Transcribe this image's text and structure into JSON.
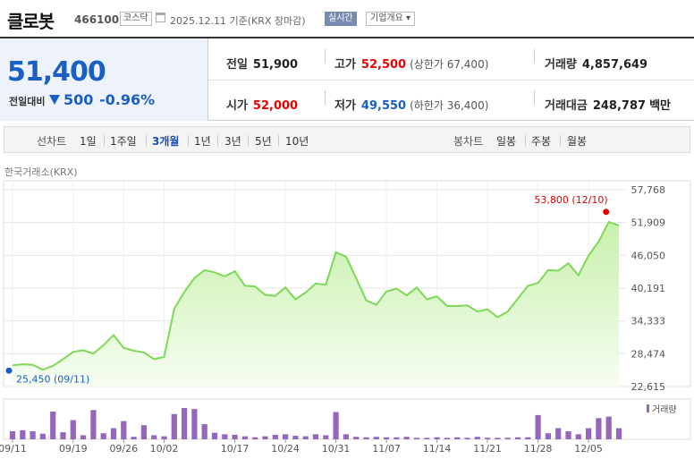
{
  "header": {
    "name": "클로봇",
    "code": "466100",
    "market": "코스닥",
    "date": "2025.12.11 기준(KRX 장마감)",
    "realtime": "실시간",
    "company_info": "기업개요 ▾"
  },
  "quote": {
    "price": "51,400",
    "change_label": "전일대비",
    "change": "500",
    "change_pct": "-0.96%",
    "prev_label": "전일",
    "prev": "51,900",
    "open_label": "시가",
    "open": "52,000",
    "high_label": "고가",
    "high": "52,500",
    "upper_limit": "(상한가 67,400)",
    "low_label": "저가",
    "low": "49,550",
    "lower_limit": "(하한가 36,400)",
    "volume_label": "거래량",
    "volume": "4,857,649",
    "amount_label": "거래대금",
    "amount": "248,787",
    "amount_unit": "백만"
  },
  "periods": {
    "line_label": "선차트",
    "line_items": [
      "1일",
      "1주일",
      "3개월",
      "1년",
      "3년",
      "5년",
      "10년"
    ],
    "active": "3개월",
    "candle_label": "봉차트",
    "candle_items": [
      "일봉",
      "주봉",
      "월봉"
    ]
  },
  "source": "한국거래소(KRX)",
  "colors": {
    "down": "#1a5fc4",
    "up": "#e00000",
    "line": "#7ed957",
    "volume": "#9467bd"
  },
  "chart_data": {
    "type": "area",
    "x_tick_labels": [
      "09/11",
      "09/19",
      "09/26",
      "10/02",
      "10/17",
      "10/24",
      "10/31",
      "11/07",
      "11/14",
      "11/21",
      "11/28",
      "12/05"
    ],
    "y_tick_labels": [
      "57,768",
      "51,909",
      "46,050",
      "40,191",
      "34,333",
      "28,474",
      "22,615"
    ],
    "ylim": [
      22615,
      57768
    ],
    "values": [
      26400,
      26600,
      26500,
      25600,
      26300,
      27500,
      28800,
      29100,
      28500,
      30000,
      31800,
      29500,
      29000,
      28700,
      27500,
      27900,
      36500,
      39500,
      42000,
      43400,
      43000,
      42300,
      43200,
      40600,
      40500,
      39000,
      38800,
      40300,
      38200,
      39400,
      41000,
      40800,
      46600,
      45800,
      42000,
      38000,
      37200,
      39600,
      40100,
      38900,
      40300,
      38200,
      38700,
      37000,
      37000,
      37100,
      36000,
      36400,
      35000,
      36000,
      38300,
      40600,
      41100,
      43400,
      43300,
      44600,
      42500,
      46000,
      48500,
      52000,
      51400
    ],
    "volume": [
      16,
      18,
      16,
      11,
      55,
      14,
      38,
      8,
      58,
      12,
      22,
      36,
      5,
      28,
      8,
      6,
      50,
      62,
      60,
      30,
      13,
      10,
      9,
      6,
      4,
      6,
      9,
      10,
      7,
      6,
      10,
      8,
      54,
      10,
      5,
      4,
      5,
      4,
      4,
      5,
      3,
      3,
      4,
      3,
      4,
      3,
      5,
      3,
      3,
      3,
      4,
      4,
      48,
      12,
      22,
      16,
      10,
      22,
      42,
      45,
      22
    ],
    "volume_legend": "거래량",
    "max_annotation": {
      "index": 59,
      "value": 53800,
      "label": "53,800 (12/10)"
    },
    "min_annotation": {
      "index": 0,
      "value": 25450,
      "label": "25,450 (09/11)"
    },
    "grid": true
  }
}
